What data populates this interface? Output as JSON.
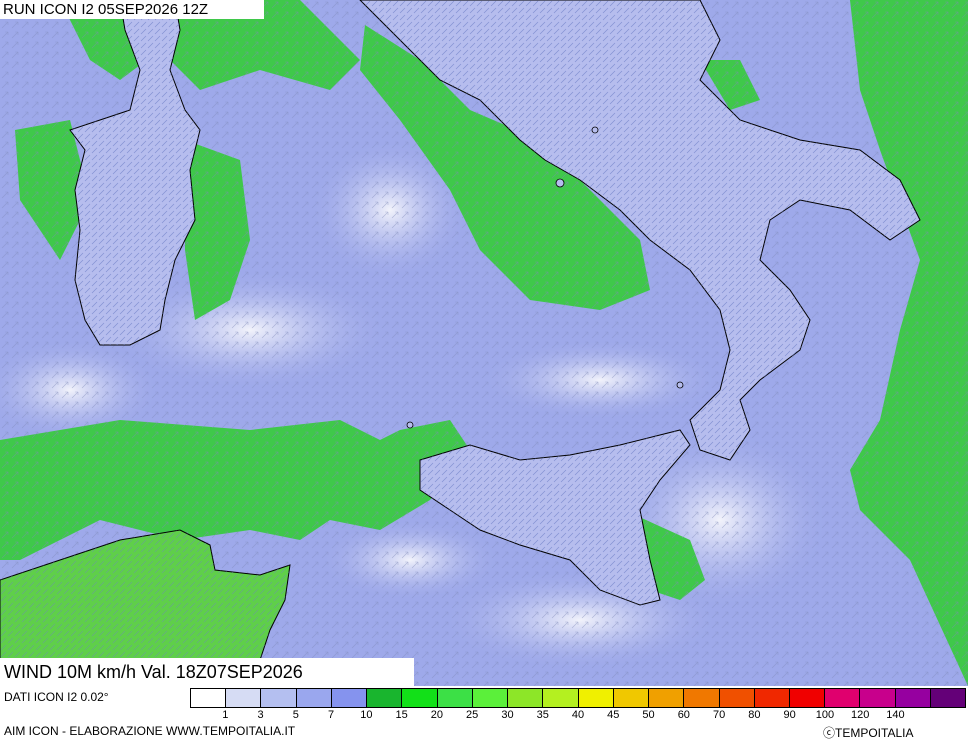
{
  "header": {
    "run_label": "RUN ICON I2 05SEP2026 12Z"
  },
  "map": {
    "variable_label": "WIND 10M km/h Val. 18Z07SEP2026"
  },
  "footer": {
    "source_label": "DATI ICON I2 0.02°",
    "credit_label": "AIM ICON - ELABORAZIONE WWW.TEMPOITALIA.IT",
    "brand_label": "ⓒTEMPOITALIA"
  },
  "legend": {
    "colors": [
      "#ffffff",
      "#d6dcf4",
      "#b4bff0",
      "#9aa7ee",
      "#8593ee",
      "#19b52e",
      "#12e018",
      "#3ce046",
      "#5bf03a",
      "#8de628",
      "#b4f020",
      "#f0f000",
      "#f0c800",
      "#f0a000",
      "#f07800",
      "#f05000",
      "#f02800",
      "#f00000",
      "#e0006e",
      "#c8008c",
      "#9600a0",
      "#640078"
    ],
    "labels": [
      "1",
      "3",
      "5",
      "7",
      "10",
      "15",
      "20",
      "25",
      "30",
      "35",
      "40",
      "45",
      "50",
      "60",
      "70",
      "80",
      "90",
      "100",
      "120",
      "140"
    ]
  }
}
